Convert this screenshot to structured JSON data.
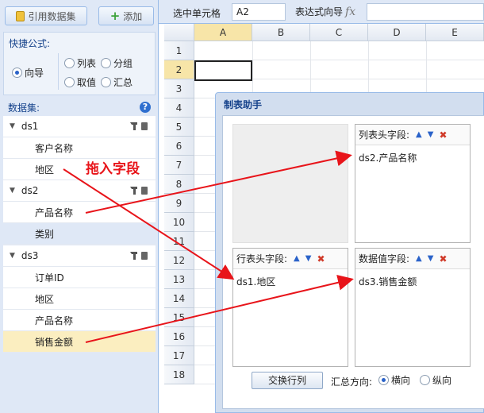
{
  "toolbar_left": {
    "cite_dataset": "引用数据集",
    "add": "添加"
  },
  "quick_formula": {
    "title": "快捷公式:",
    "options": [
      "向导",
      "列表",
      "分组",
      "取值",
      "汇总"
    ],
    "selected": "向导"
  },
  "datasets": {
    "title": "数据集:",
    "help": "?",
    "groups": [
      {
        "name": "ds1",
        "fields": [
          "客户名称",
          "地区"
        ]
      },
      {
        "name": "ds2",
        "fields": [
          "产品名称",
          "类别"
        ]
      },
      {
        "name": "ds3",
        "fields": [
          "订单ID",
          "地区",
          "产品名称",
          "销售金额"
        ]
      }
    ]
  },
  "formula_bar": {
    "selected_cell_label": "选中单元格",
    "selected_cell_value": "A2",
    "expr_wizard_label": "表达式向导",
    "fx": "fx",
    "expr_value": ""
  },
  "sheet": {
    "columns": [
      "A",
      "B",
      "C",
      "D",
      "E"
    ],
    "rows": [
      "1",
      "2",
      "3",
      "4",
      "5",
      "6",
      "7",
      "8",
      "9",
      "10",
      "11",
      "12",
      "13",
      "14",
      "15",
      "16",
      "17",
      "18"
    ],
    "active_column": "A",
    "active_row": "2"
  },
  "dialog": {
    "title": "制表助手",
    "col_header_zone": {
      "label": "列表头字段:",
      "item": "ds2.产品名称"
    },
    "row_header_zone": {
      "label": "行表头字段:",
      "item": "ds1.地区"
    },
    "value_zone": {
      "label": "数据值字段:",
      "item": "ds3.销售金额"
    },
    "swap_button": "交换行列",
    "summary_label": "汇总方向:",
    "summary_options": [
      "横向",
      "纵向"
    ],
    "summary_selected": "横向"
  },
  "annotation": "拖入字段",
  "colors": {
    "arrow": "#e8141a",
    "highlight": "#fbeec0",
    "panel": "#dfe8f6"
  },
  "icons": [
    "database-icon",
    "plus-icon",
    "help-icon",
    "wrench-icon",
    "trash-icon",
    "arrow-up-icon",
    "arrow-down-icon",
    "delete-icon",
    "fx-icon"
  ]
}
